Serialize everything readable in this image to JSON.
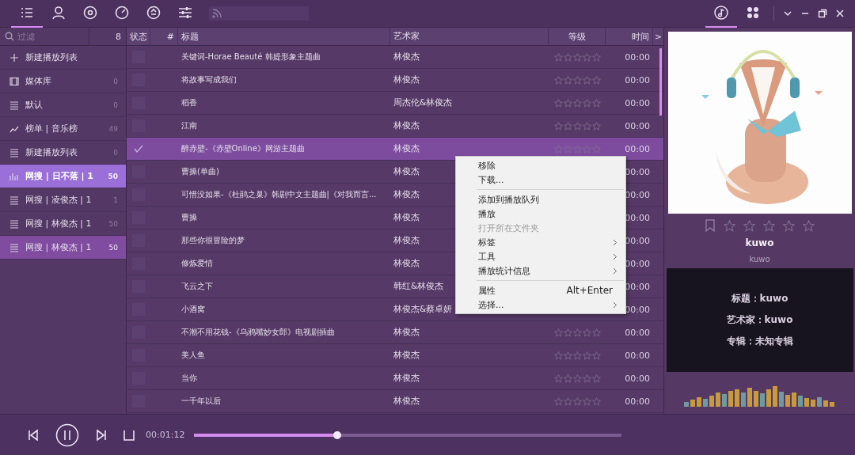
{
  "toolbar": {
    "left_tabs": [
      {
        "kind": "list",
        "selected": true
      },
      {
        "kind": "user",
        "selected": false
      },
      {
        "kind": "disc",
        "selected": false
      },
      {
        "kind": "gauge",
        "selected": false
      },
      {
        "kind": "eject",
        "selected": false
      },
      {
        "kind": "sliders",
        "selected": false
      }
    ],
    "right_tabs": [
      {
        "kind": "note",
        "selected": true
      },
      {
        "kind": "grid",
        "selected": false
      }
    ]
  },
  "sidebar": {
    "filter": {
      "placeholder": "过滤"
    },
    "count": "8",
    "items": [
      {
        "kind": "add",
        "label": "新建播放列表",
        "selected": false,
        "highlighted": false
      },
      {
        "kind": "library",
        "label": "媒体库",
        "count": "0",
        "selected": false,
        "highlighted": false
      },
      {
        "kind": "list",
        "label": "默认",
        "count": "0",
        "selected": false,
        "highlighted": false
      },
      {
        "kind": "chart",
        "label": "榜单 | 音乐榜",
        "count": "49",
        "selected": false,
        "highlighted": false
      },
      {
        "kind": "list",
        "label": "新建播放列表",
        "count": "0",
        "selected": false,
        "highlighted": false
      },
      {
        "kind": "bars",
        "label": "网搜 | 日不落 | 1",
        "count": "50",
        "selected": true,
        "highlighted": false
      },
      {
        "kind": "list",
        "label": "网搜 | 凌俊杰 | 1",
        "count": "1",
        "selected": false,
        "highlighted": false
      },
      {
        "kind": "list",
        "label": "网搜 | 林俊杰 | 1",
        "count": "50",
        "selected": false,
        "highlighted": false
      },
      {
        "kind": "list",
        "label": "网搜 | 林俊杰 | 1",
        "count": "50",
        "selected": false,
        "highlighted": true
      }
    ]
  },
  "table": {
    "columns": [
      "状态",
      "#",
      "标题",
      "艺术家",
      "等级",
      "时间"
    ],
    "more": ">",
    "rows": [
      {
        "title": "关键词-Horae Beauté 韩媞形象主题曲",
        "artist": "林俊杰",
        "stars": 0,
        "time": "00:00",
        "checked": false,
        "selected": false
      },
      {
        "title": "将故事写成我们",
        "artist": "林俊杰",
        "stars": 0,
        "time": "00:00",
        "checked": false,
        "selected": false
      },
      {
        "title": "稻香",
        "artist": "周杰伦&林俊杰",
        "stars": 0,
        "time": "00:00",
        "checked": false,
        "selected": false
      },
      {
        "title": "江南",
        "artist": "林俊杰",
        "stars": 0,
        "time": "00:00",
        "checked": false,
        "selected": false
      },
      {
        "title": "醉赤壁-《赤壁Online》网游主题曲",
        "artist": "林俊杰",
        "stars": 0,
        "time": "00:00",
        "checked": true,
        "selected": true
      },
      {
        "title": "曹操(单曲)",
        "artist": "林俊杰",
        "time": "00:00",
        "checked": false,
        "selected": false
      },
      {
        "title": "可惜没如果-《杜鹃之巢》韩剧中文主题曲|《对我而言...",
        "artist": "林俊杰",
        "time": "00:00",
        "checked": false,
        "selected": false
      },
      {
        "title": "曹操",
        "artist": "林俊杰",
        "time": "00:00",
        "checked": false,
        "selected": false
      },
      {
        "title": "那些你很冒险的梦",
        "artist": "林俊杰",
        "time": "00:00",
        "checked": false,
        "selected": false
      },
      {
        "title": "修炼爱情",
        "artist": "林俊杰",
        "time": "00:00",
        "checked": false,
        "selected": false
      },
      {
        "title": "飞云之下",
        "artist": "韩红&林俊杰",
        "time": "00:00",
        "checked": false,
        "selected": false
      },
      {
        "title": "小酒窝",
        "artist": "林俊杰&蔡卓妍",
        "time": "00:00",
        "checked": false,
        "selected": false
      },
      {
        "title": "不潮不用花钱-《乌鸦嘴妙女郎》电视剧插曲",
        "artist": "林俊杰",
        "stars": 0,
        "time": "00:00",
        "checked": false,
        "selected": false
      },
      {
        "title": "美人鱼",
        "artist": "林俊杰",
        "stars": 0,
        "time": "00:00",
        "checked": false,
        "selected": false
      },
      {
        "title": "当你",
        "artist": "林俊杰",
        "stars": 0,
        "time": "00:00",
        "checked": false,
        "selected": false
      },
      {
        "title": "一千年以后",
        "artist": "林俊杰",
        "stars": 0,
        "time": "00:00",
        "checked": false,
        "selected": false
      }
    ]
  },
  "context_menu": {
    "items": [
      {
        "kind": "item",
        "label": "移除",
        "disabled": false,
        "submenu": false
      },
      {
        "kind": "item",
        "label": "下载...",
        "disabled": false,
        "submenu": false
      },
      {
        "kind": "separator"
      },
      {
        "kind": "item",
        "label": "添加到播放队列",
        "disabled": false,
        "submenu": false
      },
      {
        "kind": "item",
        "label": "播放",
        "disabled": false,
        "submenu": false
      },
      {
        "kind": "item",
        "label": "打开所在文件夹",
        "disabled": true,
        "submenu": false
      },
      {
        "kind": "item",
        "label": "标签",
        "disabled": false,
        "submenu": true
      },
      {
        "kind": "item",
        "label": "工具",
        "disabled": false,
        "submenu": true
      },
      {
        "kind": "item",
        "label": "播放统计信息",
        "disabled": false,
        "submenu": true
      },
      {
        "kind": "separator"
      },
      {
        "kind": "item",
        "label": "属性",
        "shortcut": "Alt+Enter",
        "disabled": false,
        "submenu": false
      },
      {
        "kind": "item",
        "label": "选择...",
        "disabled": false,
        "submenu": true
      }
    ]
  },
  "now_playing": {
    "stars": 0,
    "title": "kuwo",
    "subtitle": "kuwo",
    "info": [
      "标题：kuwo",
      "艺术家：kuwo",
      "专辑：未知专辑"
    ]
  },
  "player": {
    "playing": true,
    "elapsed": "00:01:12",
    "level": 0.335
  }
}
